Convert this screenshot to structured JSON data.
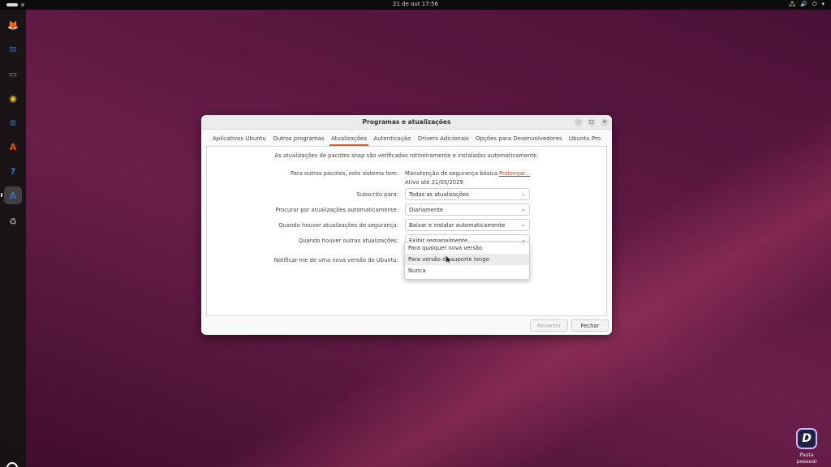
{
  "topbar": {
    "clock": "21 de out  17:56",
    "tray_icons": [
      "network-icon",
      "volume-icon",
      "power-icon",
      "menu-arrow-icon"
    ],
    "tray_glyphs": [
      "🖧",
      "🔊",
      "⏻",
      "▾"
    ]
  },
  "dock": {
    "apps": [
      {
        "name": "firefox-icon",
        "glyph": "🦊",
        "color": "#e66000"
      },
      {
        "name": "thunderbird-icon",
        "glyph": "✉",
        "color": "#2a6cc8"
      },
      {
        "name": "files-icon",
        "glyph": "▭",
        "color": "#8a8a8a"
      },
      {
        "name": "rhythmbox-icon",
        "glyph": "◉",
        "color": "#e8c21a"
      },
      {
        "name": "libreoffice-writer-icon",
        "glyph": "≡",
        "color": "#1f6fc6"
      },
      {
        "name": "app-center-icon",
        "glyph": "A",
        "color": "#e95420"
      },
      {
        "name": "help-icon",
        "glyph": "?",
        "color": "#1c7fd6"
      },
      {
        "name": "software-updater-icon",
        "glyph": "A",
        "color": "#3d6fb6"
      },
      {
        "name": "trash-icon",
        "glyph": "♻",
        "color": "#9aa39a"
      }
    ]
  },
  "desktop": {
    "home_folder_label": "Pasta pessoal",
    "home_glyph": "D"
  },
  "dialog": {
    "title": "Programas e atualizações",
    "window_buttons": {
      "minimize": "–",
      "maximize": "□",
      "close": "✕"
    },
    "tabs": [
      "Aplicativos Ubuntu",
      "Outros programas",
      "Atualizações",
      "Autenticação",
      "Drivers Adicionais",
      "Opções para Desenvolvedores",
      "Ubuntu Pro"
    ],
    "active_tab": "Atualizações",
    "notice": "As atualizações de pacotes snap são verificadas rotineiramente e instaladas automaticamente.",
    "other_packages_label": "Para outros pacotes, este sistema tem:",
    "security_maintenance": "Manutenção de segurança básica",
    "active_until": "Ativo até 31/05/2029",
    "extend_link": "Prolongar...",
    "subscribed_label": "Subscrito para:",
    "subscribed_value": "Todas as atualizações",
    "check_label": "Procurar por atualizações automaticamente:",
    "check_value": "Diariamente",
    "security_label": "Quando houver atualizações de segurança:",
    "security_value": "Baixar e instalar automaticamente",
    "other_label": "Quando houver outras atualizações:",
    "other_value": "Exibir semanalmente",
    "notify_label": "Notificar-me de uma nova versão do Ubuntu:",
    "notify_options": [
      "Para qualquer nova versão",
      "Para versão de suporte longo",
      "Nunca"
    ],
    "notify_hovered": "Para versão de suporte longo",
    "revert_button": "Reverter",
    "close_button": "Fechar"
  }
}
